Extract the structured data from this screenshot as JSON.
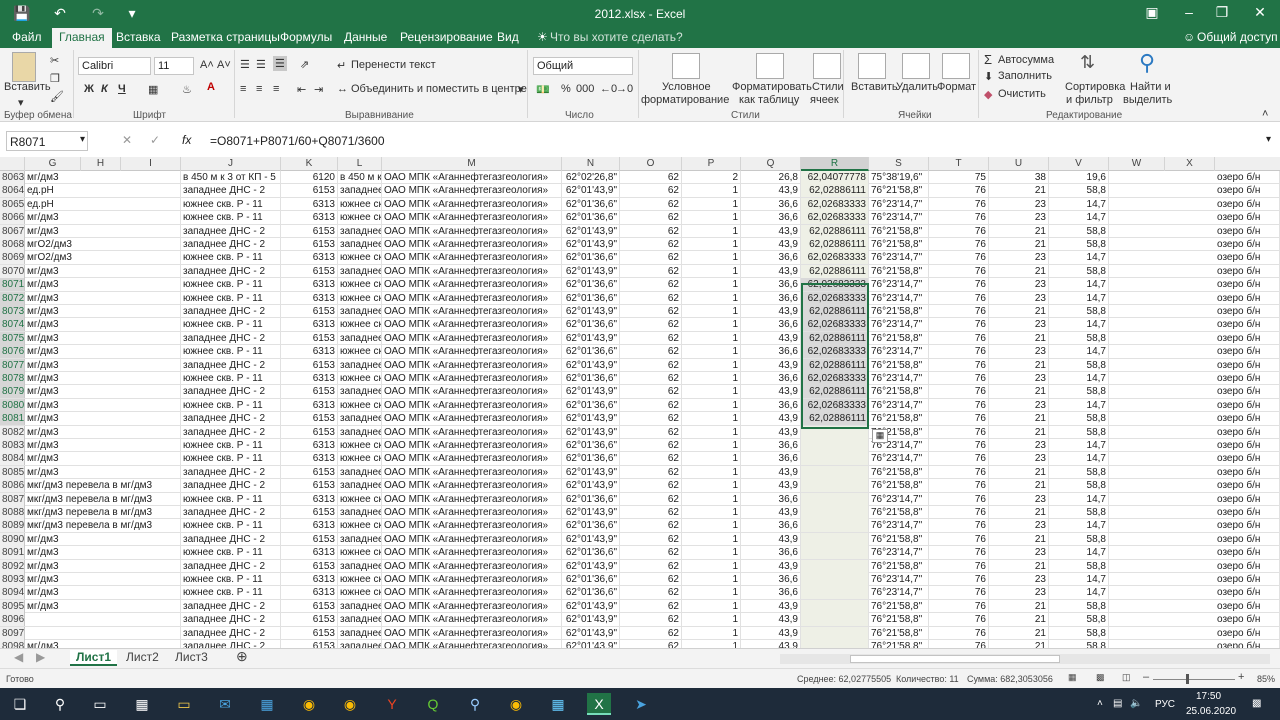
{
  "window": {
    "title": "2012.xlsx - Excel"
  },
  "tabs": [
    "Файл",
    "Главная",
    "Вставка",
    "Разметка страницы",
    "Формулы",
    "Данные",
    "Рецензирование",
    "Вид"
  ],
  "active_tab": "Главная",
  "tell_me": "Что вы хотите сделать?",
  "share": "Общий доступ",
  "ribbon": {
    "paste": "Вставить",
    "clipboard": "Буфер обмена",
    "font_name": "Calibri",
    "font_size": "11",
    "font_group": "Шрифт",
    "bold": "Ж",
    "italic": "К",
    "underline": "Ч",
    "wrap": "Перенести текст",
    "merge": "Объединить и поместить в центре",
    "align_group": "Выравнивание",
    "number_format": "Общий",
    "number_group": "Число",
    "cond_fmt_1": "Условное",
    "cond_fmt_2": "форматирование",
    "fmt_table_1": "Форматировать",
    "fmt_table_2": "как таблицу",
    "cell_styles_1": "Стили",
    "cell_styles_2": "ячеек",
    "styles_group": "Стили",
    "insert": "Вставить",
    "delete": "Удалить",
    "format": "Формат",
    "cells_group": "Ячейки",
    "autosum": "Автосумма",
    "fill": "Заполнить",
    "clear": "Очистить",
    "sort_1": "Сортировка",
    "sort_2": "и фильтр",
    "find_1": "Найти и",
    "find_2": "выделить",
    "edit_group": "Редактирование"
  },
  "formula_bar": {
    "name_box": "R8071",
    "fx": "fx",
    "formula": "=O8071+P8071/60+Q8071/3600"
  },
  "columns": [
    "G",
    "H",
    "I",
    "J",
    "K",
    "L",
    "M",
    "N",
    "O",
    "P",
    "Q",
    "R",
    "S",
    "T",
    "U",
    "V",
    "W",
    "X"
  ],
  "rows": [
    {
      "n": "8063",
      "g": "мг/дм3",
      "j": "в 450 м к 3 от КП - 5",
      "k": "6120",
      "l": "в 450 м к",
      "m": "ОАО МПК «Аганнефтегазгеология»",
      "n2": "62°02'26,8\"",
      "o": "62",
      "p": "2",
      "q": "26,8",
      "r": "62,04077778",
      "s": "75°38'19,6\"",
      "t": "75",
      "u": "38",
      "v": "19,6",
      "y": "озеро б/н"
    },
    {
      "n": "8064",
      "g": "ед.pH",
      "j": "западнее ДНС - 2",
      "k": "6153",
      "l": "западнее",
      "m": "ОАО МПК «Аганнефтегазгеология»",
      "n2": "62°01'43,9\"",
      "o": "62",
      "p": "1",
      "q": "43,9",
      "r": "62,02886111",
      "s": "76°21'58,8\"",
      "t": "76",
      "u": "21",
      "v": "58,8",
      "y": "озеро б/н"
    },
    {
      "n": "8065",
      "g": "ед.pH",
      "j": "южнее скв. Р - 11",
      "k": "6313",
      "l": "южнее ск",
      "m": "ОАО МПК «Аганнефтегазгеология»",
      "n2": "62°01'36,6\"",
      "o": "62",
      "p": "1",
      "q": "36,6",
      "r": "62,02683333",
      "s": "76°23'14,7\"",
      "t": "76",
      "u": "23",
      "v": "14,7",
      "y": "озеро б/н"
    },
    {
      "n": "8066",
      "g": "мг/дм3",
      "j": "южнее скв. Р - 11",
      "k": "6313",
      "l": "южнее ск",
      "m": "ОАО МПК «Аганнефтегазгеология»",
      "n2": "62°01'36,6\"",
      "o": "62",
      "p": "1",
      "q": "36,6",
      "r": "62,02683333",
      "s": "76°23'14,7\"",
      "t": "76",
      "u": "23",
      "v": "14,7",
      "y": "озеро б/н"
    },
    {
      "n": "8067",
      "g": "мг/дм3",
      "j": "западнее ДНС - 2",
      "k": "6153",
      "l": "западнее",
      "m": "ОАО МПК «Аганнефтегазгеология»",
      "n2": "62°01'43,9\"",
      "o": "62",
      "p": "1",
      "q": "43,9",
      "r": "62,02886111",
      "s": "76°21'58,8\"",
      "t": "76",
      "u": "21",
      "v": "58,8",
      "y": "озеро б/н"
    },
    {
      "n": "8068",
      "g": "мгO2/дм3",
      "j": "западнее ДНС - 2",
      "k": "6153",
      "l": "западнее",
      "m": "ОАО МПК «Аганнефтегазгеология»",
      "n2": "62°01'43,9\"",
      "o": "62",
      "p": "1",
      "q": "43,9",
      "r": "62,02886111",
      "s": "76°21'58,8\"",
      "t": "76",
      "u": "21",
      "v": "58,8",
      "y": "озеро б/н"
    },
    {
      "n": "8069",
      "g": "мгO2/дм3",
      "j": "южнее скв. Р - 11",
      "k": "6313",
      "l": "южнее ск",
      "m": "ОАО МПК «Аганнефтегазгеология»",
      "n2": "62°01'36,6\"",
      "o": "62",
      "p": "1",
      "q": "36,6",
      "r": "62,02683333",
      "s": "76°23'14,7\"",
      "t": "76",
      "u": "23",
      "v": "14,7",
      "y": "озеро б/н"
    },
    {
      "n": "8070",
      "g": "мг/дм3",
      "j": "западнее ДНС - 2",
      "k": "6153",
      "l": "западнее",
      "m": "ОАО МПК «Аганнефтегазгеология»",
      "n2": "62°01'43,9\"",
      "o": "62",
      "p": "1",
      "q": "43,9",
      "r": "62,02886111",
      "s": "76°21'58,8\"",
      "t": "76",
      "u": "21",
      "v": "58,8",
      "y": "озеро б/н"
    },
    {
      "n": "8071",
      "g": "мг/дм3",
      "j": "южнее скв. Р - 11",
      "k": "6313",
      "l": "южнее ск",
      "m": "ОАО МПК «Аганнефтегазгеология»",
      "n2": "62°01'36,6\"",
      "o": "62",
      "p": "1",
      "q": "36,6",
      "r": "62,02683333",
      "s": "76°23'14,7\"",
      "t": "76",
      "u": "23",
      "v": "14,7",
      "y": "озеро б/н"
    },
    {
      "n": "8072",
      "g": "мг/дм3",
      "j": "южнее скв. Р - 11",
      "k": "6313",
      "l": "южнее ск",
      "m": "ОАО МПК «Аганнефтегазгеология»",
      "n2": "62°01'36,6\"",
      "o": "62",
      "p": "1",
      "q": "36,6",
      "r": "62,02683333",
      "s": "76°23'14,7\"",
      "t": "76",
      "u": "23",
      "v": "14,7",
      "y": "озеро б/н"
    },
    {
      "n": "8073",
      "g": "мг/дм3",
      "j": "западнее ДНС - 2",
      "k": "6153",
      "l": "западнее",
      "m": "ОАО МПК «Аганнефтегазгеология»",
      "n2": "62°01'43,9\"",
      "o": "62",
      "p": "1",
      "q": "43,9",
      "r": "62,02886111",
      "s": "76°21'58,8\"",
      "t": "76",
      "u": "21",
      "v": "58,8",
      "y": "озеро б/н"
    },
    {
      "n": "8074",
      "g": "мг/дм3",
      "j": "южнее скв. Р - 11",
      "k": "6313",
      "l": "южнее ск",
      "m": "ОАО МПК «Аганнефтегазгеология»",
      "n2": "62°01'36,6\"",
      "o": "62",
      "p": "1",
      "q": "36,6",
      "r": "62,02683333",
      "s": "76°23'14,7\"",
      "t": "76",
      "u": "23",
      "v": "14,7",
      "y": "озеро б/н"
    },
    {
      "n": "8075",
      "g": "мг/дм3",
      "j": "западнее ДНС - 2",
      "k": "6153",
      "l": "западнее",
      "m": "ОАО МПК «Аганнефтегазгеология»",
      "n2": "62°01'43,9\"",
      "o": "62",
      "p": "1",
      "q": "43,9",
      "r": "62,02886111",
      "s": "76°21'58,8\"",
      "t": "76",
      "u": "21",
      "v": "58,8",
      "y": "озеро б/н"
    },
    {
      "n": "8076",
      "g": "мг/дм3",
      "j": "южнее скв. Р - 11",
      "k": "6313",
      "l": "южнее ск",
      "m": "ОАО МПК «Аганнефтегазгеология»",
      "n2": "62°01'36,6\"",
      "o": "62",
      "p": "1",
      "q": "36,6",
      "r": "62,02683333",
      "s": "76°23'14,7\"",
      "t": "76",
      "u": "23",
      "v": "14,7",
      "y": "озеро б/н"
    },
    {
      "n": "8077",
      "g": "мг/дм3",
      "j": "западнее ДНС - 2",
      "k": "6153",
      "l": "западнее",
      "m": "ОАО МПК «Аганнефтегазгеология»",
      "n2": "62°01'43,9\"",
      "o": "62",
      "p": "1",
      "q": "43,9",
      "r": "62,02886111",
      "s": "76°21'58,8\"",
      "t": "76",
      "u": "21",
      "v": "58,8",
      "y": "озеро б/н"
    },
    {
      "n": "8078",
      "g": "мг/дм3",
      "j": "южнее скв. Р - 11",
      "k": "6313",
      "l": "южнее ск",
      "m": "ОАО МПК «Аганнефтегазгеология»",
      "n2": "62°01'36,6\"",
      "o": "62",
      "p": "1",
      "q": "36,6",
      "r": "62,02683333",
      "s": "76°23'14,7\"",
      "t": "76",
      "u": "23",
      "v": "14,7",
      "y": "озеро б/н"
    },
    {
      "n": "8079",
      "g": "мг/дм3",
      "j": "западнее ДНС - 2",
      "k": "6153",
      "l": "западнее",
      "m": "ОАО МПК «Аганнефтегазгеология»",
      "n2": "62°01'43,9\"",
      "o": "62",
      "p": "1",
      "q": "43,9",
      "r": "62,02886111",
      "s": "76°21'58,8\"",
      "t": "76",
      "u": "21",
      "v": "58,8",
      "y": "озеро б/н"
    },
    {
      "n": "8080",
      "g": "мг/дм3",
      "j": "южнее скв. Р - 11",
      "k": "6313",
      "l": "южнее ск",
      "m": "ОАО МПК «Аганнефтегазгеология»",
      "n2": "62°01'36,6\"",
      "o": "62",
      "p": "1",
      "q": "36,6",
      "r": "62,02683333",
      "s": "76°23'14,7\"",
      "t": "76",
      "u": "23",
      "v": "14,7",
      "y": "озеро б/н"
    },
    {
      "n": "8081",
      "g": "мг/дм3",
      "j": "западнее ДНС - 2",
      "k": "6153",
      "l": "западнее",
      "m": "ОАО МПК «Аганнефтегазгеология»",
      "n2": "62°01'43,9\"",
      "o": "62",
      "p": "1",
      "q": "43,9",
      "r": "62,02886111",
      "s": "76°21'58,8\"",
      "t": "76",
      "u": "21",
      "v": "58,8",
      "y": "озеро б/н"
    },
    {
      "n": "8082",
      "g": "мг/дм3",
      "j": "западнее ДНС - 2",
      "k": "6153",
      "l": "западнее",
      "m": "ОАО МПК «Аганнефтегазгеология»",
      "n2": "62°01'43,9\"",
      "o": "62",
      "p": "1",
      "q": "43,9",
      "r": "",
      "s": "76°21'58,8\"",
      "t": "76",
      "u": "21",
      "v": "58,8",
      "y": "озеро б/н"
    },
    {
      "n": "8083",
      "g": "мг/дм3",
      "j": "южнее скв. Р - 11",
      "k": "6313",
      "l": "южнее ск",
      "m": "ОАО МПК «Аганнефтегазгеология»",
      "n2": "62°01'36,6\"",
      "o": "62",
      "p": "1",
      "q": "36,6",
      "r": "",
      "s": "76°23'14,7\"",
      "t": "76",
      "u": "23",
      "v": "14,7",
      "y": "озеро б/н"
    },
    {
      "n": "8084",
      "g": "мг/дм3",
      "j": "южнее скв. Р - 11",
      "k": "6313",
      "l": "южнее ск",
      "m": "ОАО МПК «Аганнефтегазгеология»",
      "n2": "62°01'36,6\"",
      "o": "62",
      "p": "1",
      "q": "36,6",
      "r": "",
      "s": "76°23'14,7\"",
      "t": "76",
      "u": "23",
      "v": "14,7",
      "y": "озеро б/н"
    },
    {
      "n": "8085",
      "g": "мг/дм3",
      "j": "западнее ДНС - 2",
      "k": "6153",
      "l": "западнее",
      "m": "ОАО МПК «Аганнефтегазгеология»",
      "n2": "62°01'43,9\"",
      "o": "62",
      "p": "1",
      "q": "43,9",
      "r": "",
      "s": "76°21'58,8\"",
      "t": "76",
      "u": "21",
      "v": "58,8",
      "y": "озеро б/н"
    },
    {
      "n": "8086",
      "g": "мкг/дм3 перевела в мг/дм3",
      "j": "западнее ДНС - 2",
      "k": "6153",
      "l": "западнее",
      "m": "ОАО МПК «Аганнефтегазгеология»",
      "n2": "62°01'43,9\"",
      "o": "62",
      "p": "1",
      "q": "43,9",
      "r": "",
      "s": "76°21'58,8\"",
      "t": "76",
      "u": "21",
      "v": "58,8",
      "y": "озеро б/н"
    },
    {
      "n": "8087",
      "g": "мкг/дм3 перевела в мг/дм3",
      "j": "южнее скв. Р - 11",
      "k": "6313",
      "l": "южнее ск",
      "m": "ОАО МПК «Аганнефтегазгеология»",
      "n2": "62°01'36,6\"",
      "o": "62",
      "p": "1",
      "q": "36,6",
      "r": "",
      "s": "76°23'14,7\"",
      "t": "76",
      "u": "23",
      "v": "14,7",
      "y": "озеро б/н"
    },
    {
      "n": "8088",
      "g": "мкг/дм3 перевела в мг/дм3",
      "j": "западнее ДНС - 2",
      "k": "6153",
      "l": "западнее",
      "m": "ОАО МПК «Аганнефтегазгеология»",
      "n2": "62°01'43,9\"",
      "o": "62",
      "p": "1",
      "q": "43,9",
      "r": "",
      "s": "76°21'58,8\"",
      "t": "76",
      "u": "21",
      "v": "58,8",
      "y": "озеро б/н"
    },
    {
      "n": "8089",
      "g": "мкг/дм3 перевела в мг/дм3",
      "j": "южнее скв. Р - 11",
      "k": "6313",
      "l": "южнее ск",
      "m": "ОАО МПК «Аганнефтегазгеология»",
      "n2": "62°01'36,6\"",
      "o": "62",
      "p": "1",
      "q": "36,6",
      "r": "",
      "s": "76°23'14,7\"",
      "t": "76",
      "u": "23",
      "v": "14,7",
      "y": "озеро б/н"
    },
    {
      "n": "8090",
      "g": "мг/дм3",
      "j": "западнее ДНС - 2",
      "k": "6153",
      "l": "западнее",
      "m": "ОАО МПК «Аганнефтегазгеология»",
      "n2": "62°01'43,9\"",
      "o": "62",
      "p": "1",
      "q": "43,9",
      "r": "",
      "s": "76°21'58,8\"",
      "t": "76",
      "u": "21",
      "v": "58,8",
      "y": "озеро б/н"
    },
    {
      "n": "8091",
      "g": "мг/дм3",
      "j": "южнее скв. Р - 11",
      "k": "6313",
      "l": "южнее ск",
      "m": "ОАО МПК «Аганнефтегазгеология»",
      "n2": "62°01'36,6\"",
      "o": "62",
      "p": "1",
      "q": "36,6",
      "r": "",
      "s": "76°23'14,7\"",
      "t": "76",
      "u": "23",
      "v": "14,7",
      "y": "озеро б/н"
    },
    {
      "n": "8092",
      "g": "мг/дм3",
      "j": "западнее ДНС - 2",
      "k": "6153",
      "l": "западнее",
      "m": "ОАО МПК «Аганнефтегазгеология»",
      "n2": "62°01'43,9\"",
      "o": "62",
      "p": "1",
      "q": "43,9",
      "r": "",
      "s": "76°21'58,8\"",
      "t": "76",
      "u": "21",
      "v": "58,8",
      "y": "озеро б/н"
    },
    {
      "n": "8093",
      "g": "мг/дм3",
      "j": "южнее скв. Р - 11",
      "k": "6313",
      "l": "южнее ск",
      "m": "ОАО МПК «Аганнефтегазгеология»",
      "n2": "62°01'36,6\"",
      "o": "62",
      "p": "1",
      "q": "36,6",
      "r": "",
      "s": "76°23'14,7\"",
      "t": "76",
      "u": "23",
      "v": "14,7",
      "y": "озеро б/н"
    },
    {
      "n": "8094",
      "g": "мг/дм3",
      "j": "южнее скв. Р - 11",
      "k": "6313",
      "l": "южнее ск",
      "m": "ОАО МПК «Аганнефтегазгеология»",
      "n2": "62°01'36,6\"",
      "o": "62",
      "p": "1",
      "q": "36,6",
      "r": "",
      "s": "76°23'14,7\"",
      "t": "76",
      "u": "23",
      "v": "14,7",
      "y": "озеро б/н"
    },
    {
      "n": "8095",
      "g": "мг/дм3",
      "j": "западнее ДНС - 2",
      "k": "6153",
      "l": "западнее",
      "m": "ОАО МПК «Аганнефтегазгеология»",
      "n2": "62°01'43,9\"",
      "o": "62",
      "p": "1",
      "q": "43,9",
      "r": "",
      "s": "76°21'58,8\"",
      "t": "76",
      "u": "21",
      "v": "58,8",
      "y": "озеро б/н"
    },
    {
      "n": "8096",
      "g": "",
      "j": "западнее ДНС - 2",
      "k": "6153",
      "l": "западнее",
      "m": "ОАО МПК «Аганнефтегазгеология»",
      "n2": "62°01'43,9\"",
      "o": "62",
      "p": "1",
      "q": "43,9",
      "r": "",
      "s": "76°21'58,8\"",
      "t": "76",
      "u": "21",
      "v": "58,8",
      "y": "озеро б/н"
    },
    {
      "n": "8097",
      "g": "",
      "j": "западнее ДНС - 2",
      "k": "6153",
      "l": "западнее",
      "m": "ОАО МПК «Аганнефтегазгеология»",
      "n2": "62°01'43,9\"",
      "o": "62",
      "p": "1",
      "q": "43,9",
      "r": "",
      "s": "76°21'58,8\"",
      "t": "76",
      "u": "21",
      "v": "58,8",
      "y": "озеро б/н"
    },
    {
      "n": "8098",
      "g": "мг/дм3",
      "j": "западнее ДНС - 2",
      "k": "6153",
      "l": "западнее",
      "m": "ОАО МПК «Аганнефтегазгеология»",
      "n2": "62°01'43,9\"",
      "o": "62",
      "p": "1",
      "q": "43,9",
      "r": "",
      "s": "76°21'58,8\"",
      "t": "76",
      "u": "21",
      "v": "58,8",
      "y": "озеро б/н"
    }
  ],
  "sheets": [
    "Лист1",
    "Лист2",
    "Лист3"
  ],
  "active_sheet": "Лист1",
  "status": {
    "ready": "Готово",
    "average": "Среднее: 62,02775505",
    "count": "Количество: 11",
    "sum": "Сумма: 682,3053056",
    "zoom": "85%"
  },
  "taskbar": {
    "lang": "РУС",
    "time": "17:50",
    "date": "25.06.2020"
  },
  "colors": {
    "accent": "#217346",
    "selection": "#217346"
  }
}
